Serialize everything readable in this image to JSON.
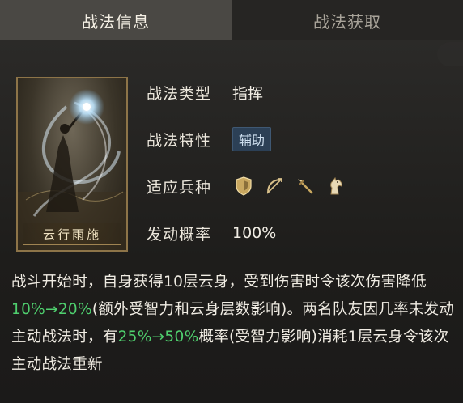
{
  "tabs": [
    {
      "label": "战法信息",
      "active": true
    },
    {
      "label": "战法获取",
      "active": false
    }
  ],
  "card": {
    "name": "云行雨施"
  },
  "info": {
    "type_label": "战法类型",
    "type_value": "指挥",
    "trait_label": "战法特性",
    "trait_value": "辅助",
    "units_label": "适应兵种",
    "units": [
      "shield-icon",
      "bow-icon",
      "spear-icon",
      "horse-icon"
    ],
    "rate_label": "发动概率",
    "rate_value": "100%"
  },
  "description": {
    "p1": "战斗开始时，自身获得10层云身，受到伤害时令该次伤害降低",
    "hl1": "10%→20%",
    "p2": "(额外受智力和云身层数影响)。两名队友因几率未发动主动战法时，有",
    "hl2": "25%→50%",
    "p3": "概率(受智力影响)消耗1层云身令该次主动战法重新"
  },
  "colors": {
    "accent_green": "#4fcf6e",
    "tab_active": "#4a4844",
    "badge_bg": "#2c4056"
  }
}
